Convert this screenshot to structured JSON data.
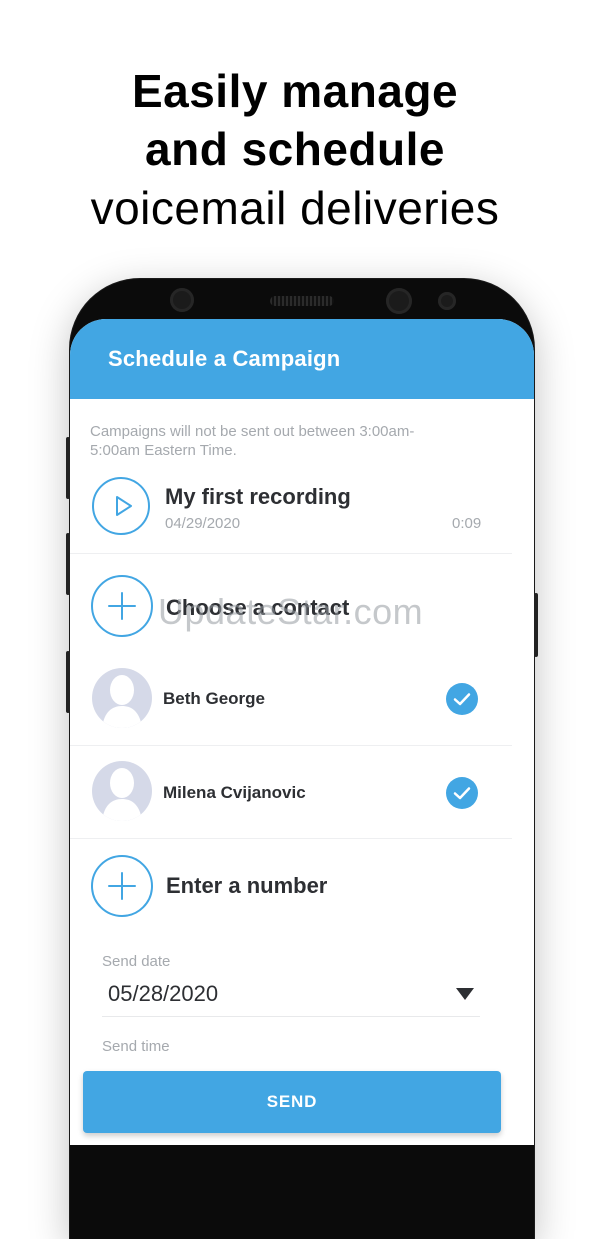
{
  "headline": {
    "line1": "Easily manage",
    "line2": "and schedule",
    "line3": "voicemail deliveries"
  },
  "app": {
    "title": "Schedule a Campaign",
    "notice": "Campaigns will not be sent out between 3:00am-5:00am Eastern Time.",
    "recording": {
      "title": "My first recording",
      "date": "04/29/2020",
      "duration": "0:09",
      "icon": "play-icon"
    },
    "choose_contact": {
      "label": "Choose a contact",
      "icon": "plus-icon"
    },
    "contacts": [
      {
        "name": "Beth George",
        "selected": true
      },
      {
        "name": "Milena Cvijanovic",
        "selected": true
      }
    ],
    "enter_number": {
      "label": "Enter a number",
      "icon": "plus-icon"
    },
    "send_date": {
      "label": "Send date",
      "value": "05/28/2020"
    },
    "send_time": {
      "label": "Send time"
    },
    "send_button": "SEND"
  },
  "watermark": "UpdateStar.com",
  "colors": {
    "accent": "#42a6e3",
    "text_dark": "#2d2f33",
    "text_muted": "#a5a9ae",
    "avatar_bg": "#d5d9e8"
  }
}
